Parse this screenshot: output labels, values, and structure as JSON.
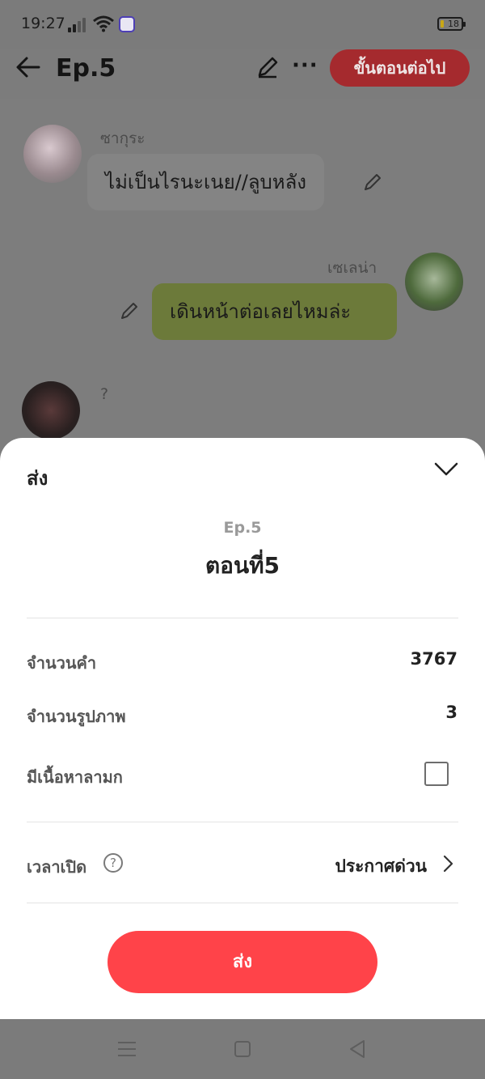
{
  "status_bar": {
    "time": "19:27",
    "battery": "18"
  },
  "header": {
    "title": "Ep.5",
    "next_label": "ขั้นตอนต่อไป"
  },
  "chat": {
    "messages": [
      {
        "sender": "ซากุระ",
        "text": "ไม่เป็นไรนะเนย//ลูบหลัง",
        "side": "left"
      },
      {
        "sender": "เซเลน่า",
        "text": "เดินหน้าต่อเลยไหมล่ะ",
        "side": "right"
      },
      {
        "sender": "?",
        "text": "",
        "side": "left"
      }
    ]
  },
  "sheet": {
    "title": "ส่ง",
    "episode_label": "Ep.5",
    "episode_name": "ตอนที่5",
    "word_count_label": "จำนวนคำ",
    "word_count": "3767",
    "image_count_label": "จำนวนรูปภาพ",
    "image_count": "3",
    "adult_content_label": "มีเนื้อหาลามก",
    "adult_content_checked": false,
    "open_time_label": "เวลาเปิด",
    "open_time_value": "ประกาศด่วน",
    "submit_label": "ส่ง"
  },
  "icons": {
    "back": "arrow-left-icon",
    "edit": "pencil-icon",
    "more": "more-icon",
    "collapse": "chevron-down-icon",
    "help": "question-circle-icon",
    "forward": "chevron-right-icon"
  },
  "colors": {
    "accent": "#ff4349",
    "header_button": "#a52a2e",
    "right_bubble": "#6c7a3a"
  }
}
